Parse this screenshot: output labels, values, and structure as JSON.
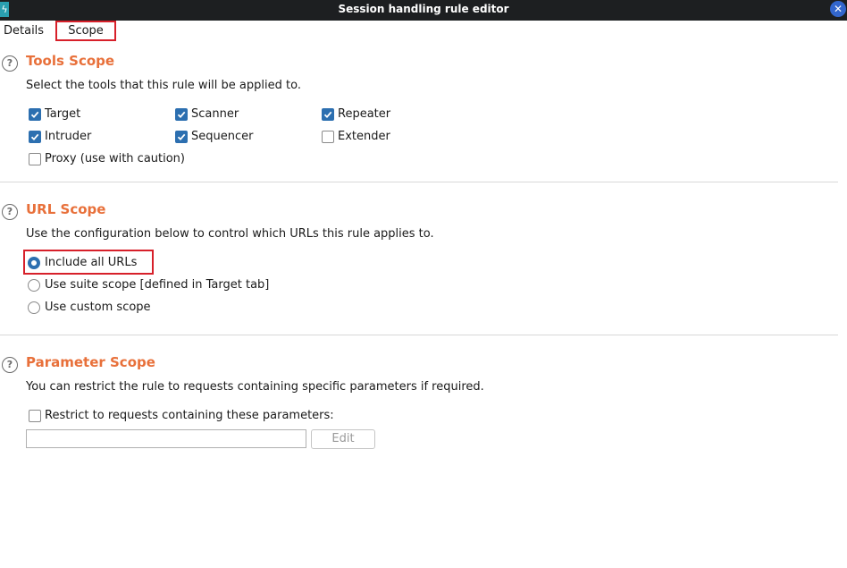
{
  "window": {
    "title": "Session handling rule editor",
    "close_glyph": "✕"
  },
  "tabs": [
    {
      "label": "Details"
    },
    {
      "label": "Scope"
    }
  ],
  "tools_scope": {
    "title": "Tools Scope",
    "description": "Select the tools that this rule will be applied to.",
    "tools": [
      {
        "label": "Target",
        "checked": true
      },
      {
        "label": "Scanner",
        "checked": true
      },
      {
        "label": "Repeater",
        "checked": true
      },
      {
        "label": "Intruder",
        "checked": true
      },
      {
        "label": "Sequencer",
        "checked": true
      },
      {
        "label": "Extender",
        "checked": false
      },
      {
        "label": "Proxy (use with caution)",
        "checked": false
      }
    ]
  },
  "url_scope": {
    "title": "URL Scope",
    "description": "Use the configuration below to control which URLs this rule applies to.",
    "options": [
      {
        "label": "Include all URLs",
        "selected": true
      },
      {
        "label": "Use suite scope [defined in Target tab]",
        "selected": false
      },
      {
        "label": "Use custom scope",
        "selected": false
      }
    ]
  },
  "parameter_scope": {
    "title": "Parameter Scope",
    "description": "You can restrict the rule to requests containing specific parameters if required.",
    "restrict_label": "Restrict to requests containing these parameters:",
    "restrict_checked": false,
    "input_value": "",
    "edit_label": "Edit"
  },
  "colors": {
    "accent_orange": "#e8703a",
    "check_blue": "#2c6fb0",
    "highlight_red": "#d7202a",
    "titlebar": "#1d1f21"
  }
}
